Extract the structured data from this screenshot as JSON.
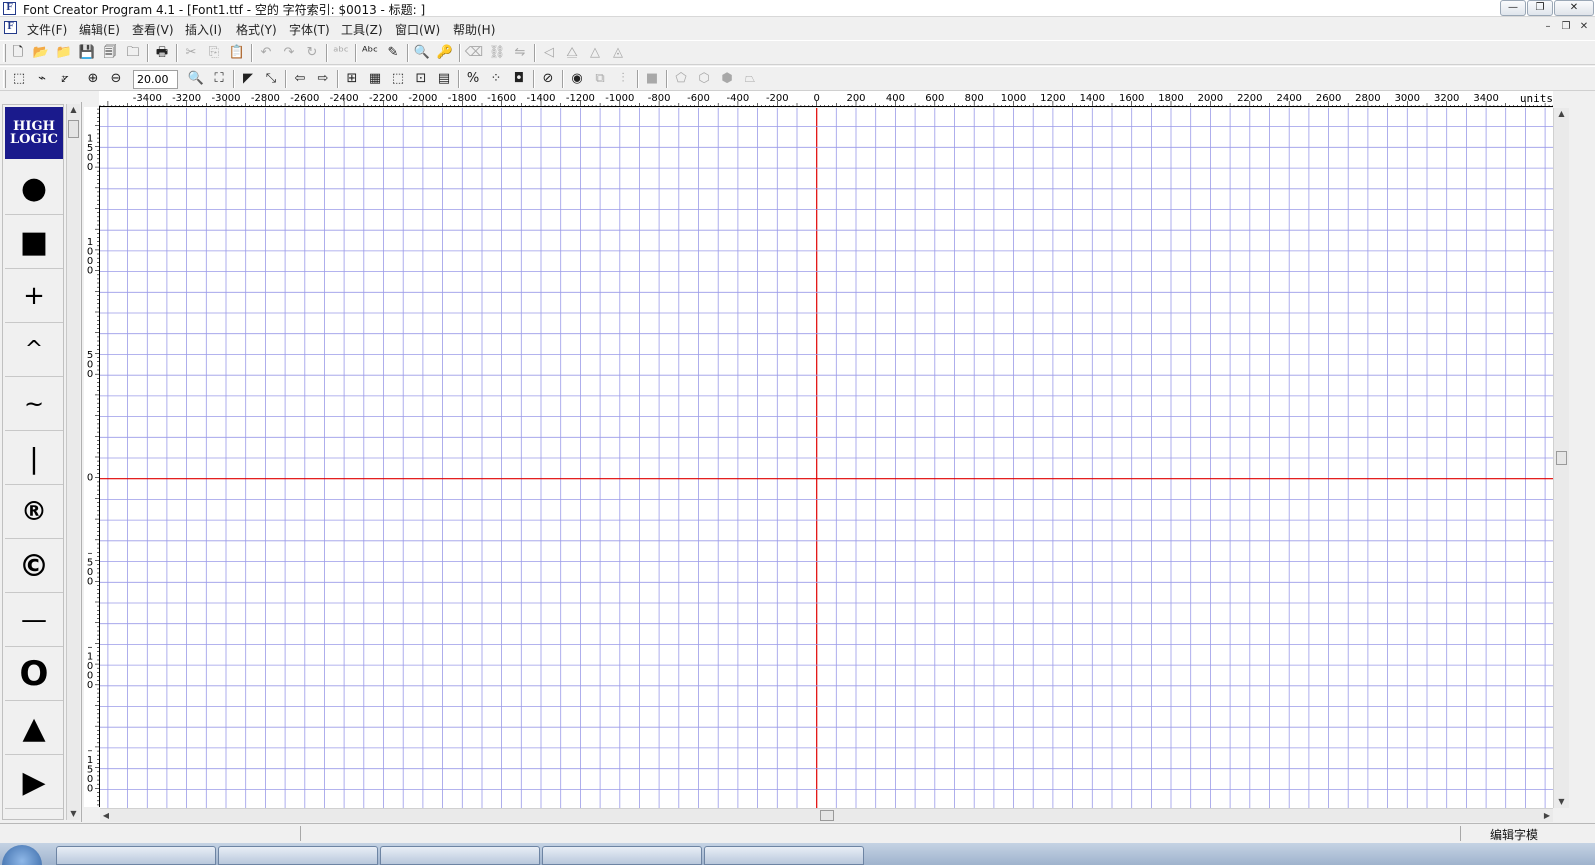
{
  "window": {
    "title": "Font Creator Program 4.1 - [Font1.ttf - 空的 字符索引: $0013 - 标题: ]",
    "app_icon_glyph": "F",
    "min_glyph": "—",
    "restore_glyph": "❐",
    "close_glyph": "✕"
  },
  "menu": {
    "items": [
      "文件(F)",
      "编辑(E)",
      "查看(V)",
      "插入(I)",
      "格式(Y)",
      "字体(T)",
      "工具(Z)",
      "窗口(W)",
      "帮助(H)"
    ],
    "mdi_min": "–",
    "mdi_restore": "❐",
    "mdi_close": "✕"
  },
  "toolbar1": {
    "buttons": [
      {
        "name": "new-icon",
        "glyph": "🗋",
        "enabled": true
      },
      {
        "name": "open-icon",
        "glyph": "📂",
        "enabled": true
      },
      {
        "name": "open-folder-icon",
        "glyph": "📁",
        "enabled": true
      },
      {
        "name": "save-icon",
        "glyph": "💾",
        "enabled": true
      },
      {
        "name": "save-all-icon",
        "glyph": "🗐",
        "enabled": true
      },
      {
        "name": "open-project-icon",
        "glyph": "🗀",
        "enabled": true
      },
      {
        "name": "print-icon",
        "glyph": "🖶",
        "enabled": true
      },
      {
        "name": "cut-icon",
        "glyph": "✂",
        "enabled": false
      },
      {
        "name": "copy-icon",
        "glyph": "⎘",
        "enabled": false
      },
      {
        "name": "paste-icon",
        "glyph": "📋",
        "enabled": true
      },
      {
        "name": "undo-icon",
        "glyph": "↶",
        "enabled": false
      },
      {
        "name": "redo-icon",
        "glyph": "↷",
        "enabled": false
      },
      {
        "name": "refresh-icon",
        "glyph": "↻",
        "enabled": false
      },
      {
        "name": "abc-dim-icon",
        "glyph": "ᵃᵇᶜ",
        "enabled": false
      },
      {
        "name": "spell-icon",
        "glyph": "ᴬᵇᶜ",
        "enabled": true
      },
      {
        "name": "pencil-icon",
        "glyph": "✎",
        "enabled": true
      },
      {
        "name": "preview-icon",
        "glyph": "🔍",
        "enabled": true
      },
      {
        "name": "key-icon",
        "glyph": "🔑",
        "enabled": true
      },
      {
        "name": "eraser-icon",
        "glyph": "⌫",
        "enabled": false
      },
      {
        "name": "link-icon",
        "glyph": "⛓",
        "enabled": false
      },
      {
        "name": "split-icon",
        "glyph": "⇋",
        "enabled": false
      },
      {
        "name": "flip-left-icon",
        "glyph": "◁",
        "enabled": false
      },
      {
        "name": "mirror-icon",
        "glyph": "⧋",
        "enabled": false
      },
      {
        "name": "rotate-icon",
        "glyph": "△",
        "enabled": false
      },
      {
        "name": "skew-icon",
        "glyph": "◬",
        "enabled": false
      }
    ]
  },
  "toolbar2": {
    "zoom_value": "20.00",
    "buttons_a": [
      {
        "name": "select-rect-icon",
        "glyph": "⬚",
        "enabled": true
      },
      {
        "name": "lasso-icon",
        "glyph": "⌁",
        "enabled": true
      },
      {
        "name": "measure-icon",
        "glyph": "⦫",
        "enabled": true
      },
      {
        "name": "zoom-in-icon",
        "glyph": "⊕",
        "enabled": true
      },
      {
        "name": "zoom-out-icon",
        "glyph": "⊖",
        "enabled": true
      }
    ],
    "buttons_b": [
      {
        "name": "zoom-icon",
        "glyph": "🔍",
        "enabled": true
      },
      {
        "name": "zoom-fit-icon",
        "glyph": "⛶",
        "enabled": true
      },
      {
        "name": "pointer-icon",
        "glyph": "◤",
        "enabled": true
      },
      {
        "name": "node-pointer-icon",
        "glyph": "⤡",
        "enabled": true
      },
      {
        "name": "arrow-left-icon",
        "glyph": "⇦",
        "enabled": true
      },
      {
        "name": "arrow-right-icon",
        "glyph": "⇨",
        "enabled": true
      },
      {
        "name": "grid-icon",
        "glyph": "⊞",
        "enabled": true
      },
      {
        "name": "grid-red-icon",
        "glyph": "▦",
        "enabled": true
      },
      {
        "name": "guides-icon",
        "glyph": "⬚",
        "enabled": true
      },
      {
        "name": "metrics-icon",
        "glyph": "⊡",
        "enabled": true
      },
      {
        "name": "hints-icon",
        "glyph": "▤",
        "enabled": true
      },
      {
        "name": "percent-icon",
        "glyph": "%",
        "enabled": true
      },
      {
        "name": "points-icon",
        "glyph": "⁘",
        "enabled": true
      },
      {
        "name": "bounds-icon",
        "glyph": "◘",
        "enabled": true
      },
      {
        "name": "compass-icon",
        "glyph": "⊘",
        "enabled": true
      },
      {
        "name": "target-icon",
        "glyph": "◉",
        "enabled": true
      },
      {
        "name": "combine-icon",
        "glyph": "⧉",
        "enabled": false
      },
      {
        "name": "align-icon",
        "glyph": "⫶",
        "enabled": false
      },
      {
        "name": "stop-icon",
        "glyph": "■",
        "enabled": false
      },
      {
        "name": "contour-a-icon",
        "glyph": "⬠",
        "enabled": false
      },
      {
        "name": "contour-b-icon",
        "glyph": "⬡",
        "enabled": false
      },
      {
        "name": "contour-c-icon",
        "glyph": "⬢",
        "enabled": false
      },
      {
        "name": "contour-d-icon",
        "glyph": "⏢",
        "enabled": false
      }
    ]
  },
  "palette": {
    "logo_lines": [
      "HIGH",
      "LOGIC"
    ],
    "glyphs": [
      {
        "name": "filled-circle-glyph",
        "glyph": "●"
      },
      {
        "name": "filled-square-glyph",
        "glyph": "■"
      },
      {
        "name": "plus-glyph",
        "glyph": "+"
      },
      {
        "name": "caret-glyph",
        "glyph": "^"
      },
      {
        "name": "tilde-glyph",
        "glyph": "~"
      },
      {
        "name": "bar-glyph",
        "glyph": "|"
      },
      {
        "name": "registered-glyph",
        "glyph": "®"
      },
      {
        "name": "copyright-glyph",
        "glyph": "©"
      },
      {
        "name": "dash-glyph",
        "glyph": "—"
      },
      {
        "name": "ring-glyph",
        "glyph": "O"
      },
      {
        "name": "triangle-up-glyph",
        "glyph": "▲"
      },
      {
        "name": "triangle-right-glyph",
        "glyph": "▶"
      }
    ]
  },
  "ruler": {
    "x_ticks": [
      -3400,
      -3200,
      -3000,
      -2800,
      -2600,
      -2400,
      -2200,
      -2000,
      -1800,
      -1600,
      -1400,
      -1200,
      -1000,
      -800,
      -600,
      -400,
      -200,
      0,
      200,
      400,
      600,
      800,
      1000,
      1200,
      1400,
      1600,
      1800,
      2000,
      2200,
      2400,
      2600,
      2800,
      3000,
      3200,
      3400
    ],
    "units_label": "units",
    "y_ticks": [
      "1500",
      "1000",
      "500",
      "0",
      "-500",
      "-1000",
      "-1500"
    ]
  },
  "canvas": {
    "x_range": [
      -3640,
      3740
    ],
    "y_range": [
      -1590,
      1790
    ],
    "minor_step": 100,
    "grid_color": "#9a9ae8",
    "axis_color": "#e00000"
  },
  "status": {
    "text": "编辑字模"
  }
}
